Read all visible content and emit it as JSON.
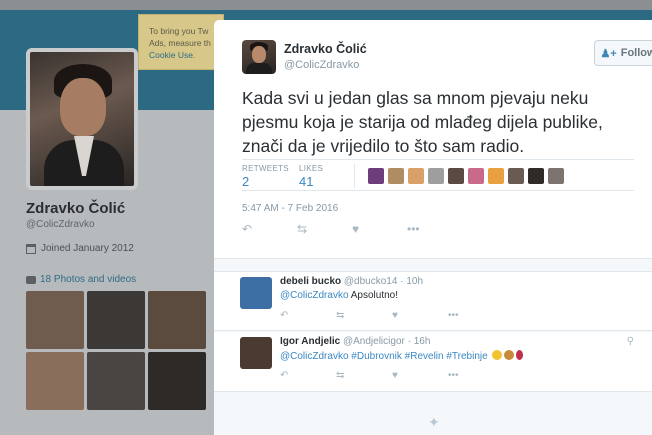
{
  "background": {
    "profile_name": "Zdravko Čolić",
    "profile_handle": "@ColicZdravko",
    "joined": "Joined January 2012",
    "photos_label": "18 Photos and videos",
    "cookie_notice": "To bring you Tw Ads, measure th",
    "cookie_link": "Cookie Use.",
    "photo_colors": [
      "#6f5c4f",
      "#3b3836",
      "#5b4a3e",
      "#8a6e5c",
      "#4a4542",
      "#2e2a28"
    ]
  },
  "tweet": {
    "author_name": "Zdravko Čolić",
    "author_handle": "@ColicZdravko",
    "follow_label": "Follow",
    "text": "Kada svi u jedan glas sa mnom pjevaju neku pjesmu koja je starija od mlađeg dijela publike, znači da je vrijedilo to što sam radio.",
    "retweets_label": "RETWEETS",
    "retweets_count": "2",
    "likes_label": "LIKES",
    "likes_count": "41",
    "liker_colors": [
      "#6c3d7a",
      "#b08c62",
      "#d9a06a",
      "#9e9e9e",
      "#5b4a44",
      "#c96a8a",
      "#e8a040",
      "#6a5a52",
      "#2d2a28",
      "#7d7470"
    ],
    "timestamp": "5:47 AM - 7 Feb 2016",
    "actions": [
      "reply-icon",
      "retweet-icon",
      "like-icon",
      "more-icon"
    ]
  },
  "replies": [
    {
      "name": "debeli bucko",
      "handle": "@dbucko14",
      "time": "· 10h",
      "mention": "@ColicZdravko",
      "text": " Apsolutno!",
      "avatar_color": "#3d6fa5"
    },
    {
      "name": "Igor Andjelic",
      "handle": "@Andjelicigor",
      "time": "· 16h",
      "mention": "@ColicZdravko",
      "hashtags": "#Dubrovnik #Revelin #Trebinje",
      "avatar_color": "#4a3a30"
    }
  ]
}
